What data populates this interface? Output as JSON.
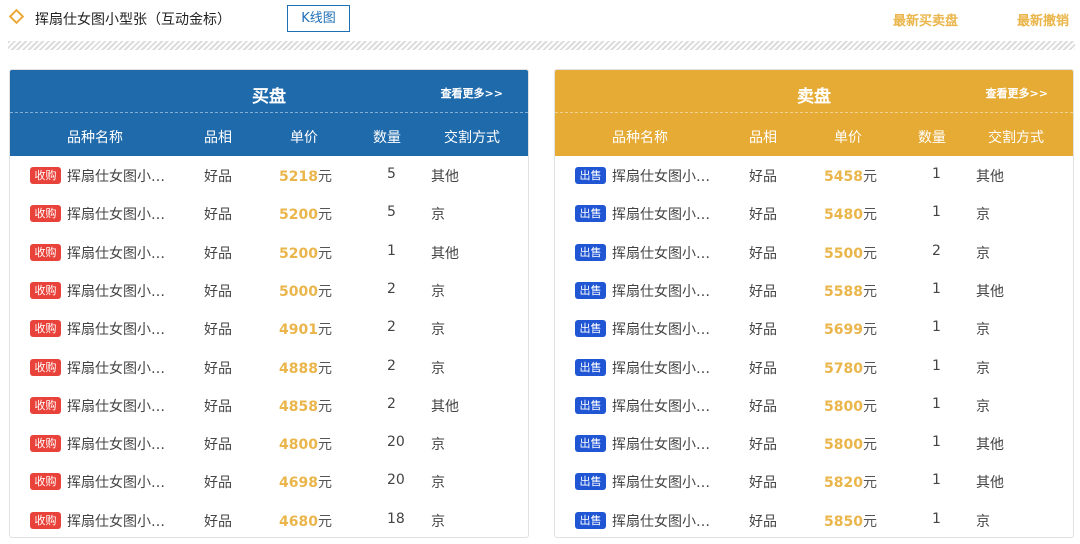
{
  "header": {
    "title": "挥扇仕女图小型张（互动金标）",
    "kline_button": "K线图",
    "link_latest_trades": "最新买卖盘",
    "link_latest_cancel": "最新撤销"
  },
  "colors": {
    "accent": "#eab64b",
    "buy_header": "#1f6aab",
    "sell_header": "#e6ab34",
    "buy_badge": "#e8423a",
    "sell_badge": "#2056d4"
  },
  "columns": [
    "品种名称",
    "品相",
    "单价",
    "数量",
    "交割方式"
  ],
  "buy_panel": {
    "title": "买盘",
    "more": "查看更多>>",
    "badge": "收购",
    "rows": [
      {
        "name": "挥扇仕女图小…",
        "quality": "好品",
        "price": "5218",
        "unit": "元",
        "qty": "5",
        "delivery": "其他"
      },
      {
        "name": "挥扇仕女图小…",
        "quality": "好品",
        "price": "5200",
        "unit": "元",
        "qty": "5",
        "delivery": "京"
      },
      {
        "name": "挥扇仕女图小…",
        "quality": "好品",
        "price": "5200",
        "unit": "元",
        "qty": "1",
        "delivery": "其他"
      },
      {
        "name": "挥扇仕女图小…",
        "quality": "好品",
        "price": "5000",
        "unit": "元",
        "qty": "2",
        "delivery": "京"
      },
      {
        "name": "挥扇仕女图小…",
        "quality": "好品",
        "price": "4901",
        "unit": "元",
        "qty": "2",
        "delivery": "京"
      },
      {
        "name": "挥扇仕女图小…",
        "quality": "好品",
        "price": "4888",
        "unit": "元",
        "qty": "2",
        "delivery": "京"
      },
      {
        "name": "挥扇仕女图小…",
        "quality": "好品",
        "price": "4858",
        "unit": "元",
        "qty": "2",
        "delivery": "其他"
      },
      {
        "name": "挥扇仕女图小…",
        "quality": "好品",
        "price": "4800",
        "unit": "元",
        "qty": "20",
        "delivery": "京"
      },
      {
        "name": "挥扇仕女图小…",
        "quality": "好品",
        "price": "4698",
        "unit": "元",
        "qty": "20",
        "delivery": "京"
      },
      {
        "name": "挥扇仕女图小…",
        "quality": "好品",
        "price": "4680",
        "unit": "元",
        "qty": "18",
        "delivery": "京"
      }
    ]
  },
  "sell_panel": {
    "title": "卖盘",
    "more": "查看更多>>",
    "badge": "出售",
    "rows": [
      {
        "name": "挥扇仕女图小…",
        "quality": "好品",
        "price": "5458",
        "unit": "元",
        "qty": "1",
        "delivery": "其他"
      },
      {
        "name": "挥扇仕女图小…",
        "quality": "好品",
        "price": "5480",
        "unit": "元",
        "qty": "1",
        "delivery": "京"
      },
      {
        "name": "挥扇仕女图小…",
        "quality": "好品",
        "price": "5500",
        "unit": "元",
        "qty": "2",
        "delivery": "京"
      },
      {
        "name": "挥扇仕女图小…",
        "quality": "好品",
        "price": "5588",
        "unit": "元",
        "qty": "1",
        "delivery": "其他"
      },
      {
        "name": "挥扇仕女图小…",
        "quality": "好品",
        "price": "5699",
        "unit": "元",
        "qty": "1",
        "delivery": "京"
      },
      {
        "name": "挥扇仕女图小…",
        "quality": "好品",
        "price": "5780",
        "unit": "元",
        "qty": "1",
        "delivery": "京"
      },
      {
        "name": "挥扇仕女图小…",
        "quality": "好品",
        "price": "5800",
        "unit": "元",
        "qty": "1",
        "delivery": "京"
      },
      {
        "name": "挥扇仕女图小…",
        "quality": "好品",
        "price": "5800",
        "unit": "元",
        "qty": "1",
        "delivery": "其他"
      },
      {
        "name": "挥扇仕女图小…",
        "quality": "好品",
        "price": "5820",
        "unit": "元",
        "qty": "1",
        "delivery": "其他"
      },
      {
        "name": "挥扇仕女图小…",
        "quality": "好品",
        "price": "5850",
        "unit": "元",
        "qty": "1",
        "delivery": "京"
      }
    ]
  }
}
